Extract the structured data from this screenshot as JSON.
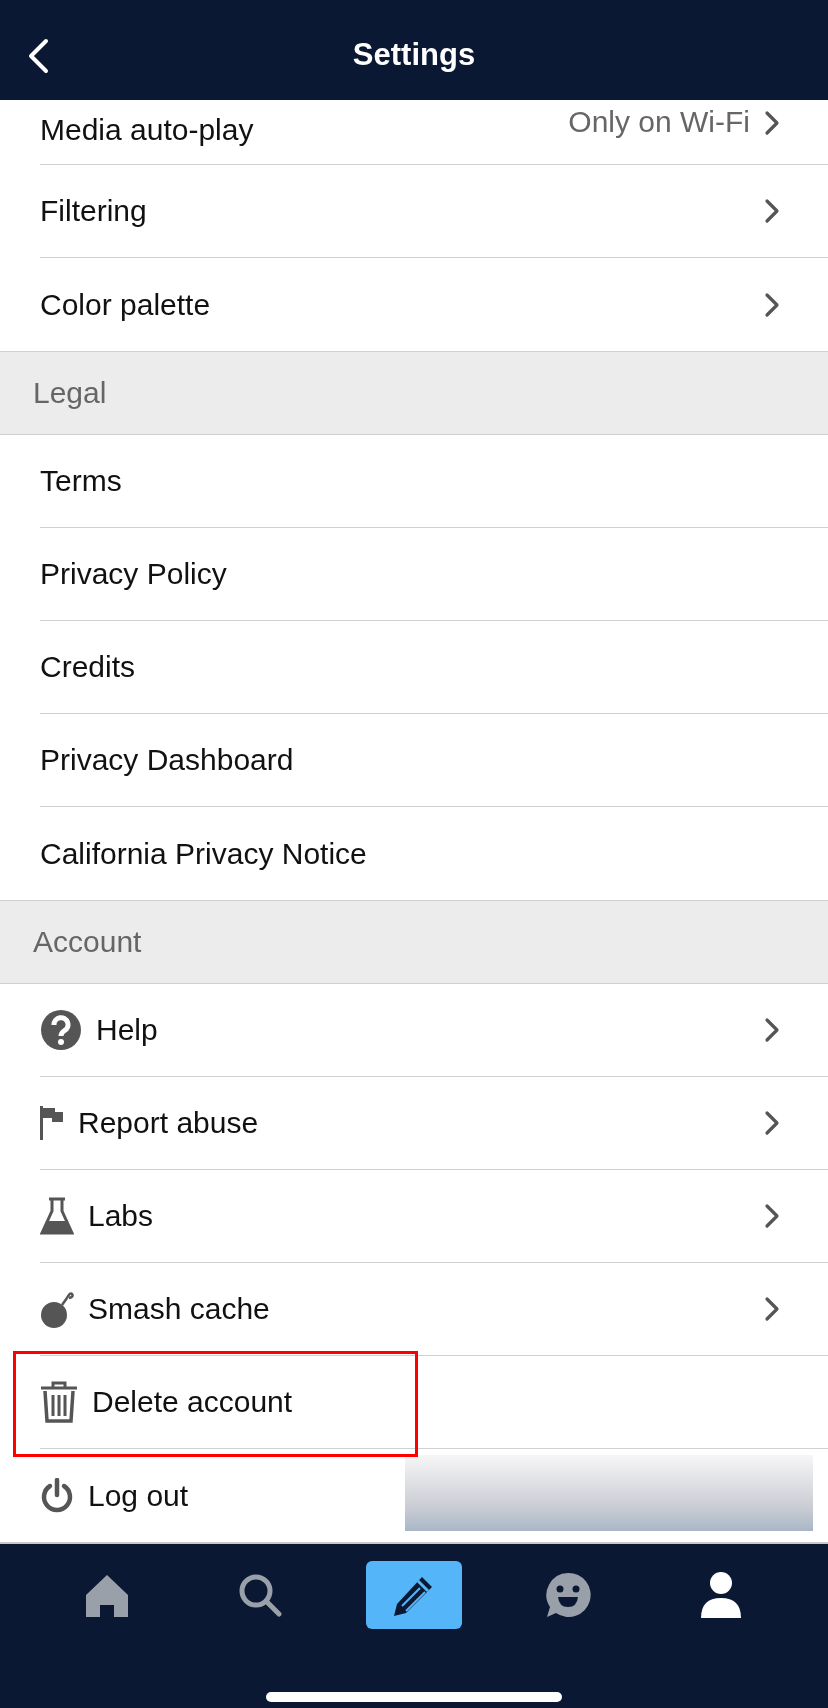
{
  "header": {
    "title": "Settings"
  },
  "sections": [
    {
      "items": [
        {
          "label": "Media auto-play",
          "value": "Only on Wi-Fi",
          "chevron": true,
          "highlighted": false
        },
        {
          "label": "Filtering",
          "chevron": true,
          "highlighted": false
        },
        {
          "label": "Color palette",
          "chevron": true,
          "highlighted": false
        }
      ]
    },
    {
      "title": "Legal",
      "items": [
        {
          "label": "Terms",
          "chevron": false,
          "highlighted": false
        },
        {
          "label": "Privacy Policy",
          "chevron": false,
          "highlighted": false
        },
        {
          "label": "Credits",
          "chevron": false,
          "highlighted": false
        },
        {
          "label": "Privacy Dashboard",
          "chevron": false,
          "highlighted": false
        },
        {
          "label": "California Privacy Notice",
          "chevron": false,
          "highlighted": false
        }
      ]
    },
    {
      "title": "Account",
      "items": [
        {
          "label": "Help",
          "kind": "icon",
          "chevron": true,
          "highlighted": false
        },
        {
          "label": "Report abuse",
          "kind": "icon",
          "chevron": true,
          "highlighted": false
        },
        {
          "label": "Labs",
          "kind": "icon",
          "chevron": true,
          "highlighted": false
        },
        {
          "label": "Smash cache",
          "kind": "icon",
          "chevron": true,
          "highlighted": false
        },
        {
          "label": "Delete account",
          "kind": "icon",
          "chevron": false,
          "highlighted": true
        },
        {
          "label": "Log out",
          "kind": "icon",
          "chevron": false,
          "highlighted": false
        }
      ]
    }
  ],
  "tab_bar": {
    "tabs": [
      {
        "selected": false
      },
      {
        "selected": false
      },
      {
        "selected": false
      },
      {
        "selected": false
      },
      {
        "selected": true
      }
    ]
  }
}
